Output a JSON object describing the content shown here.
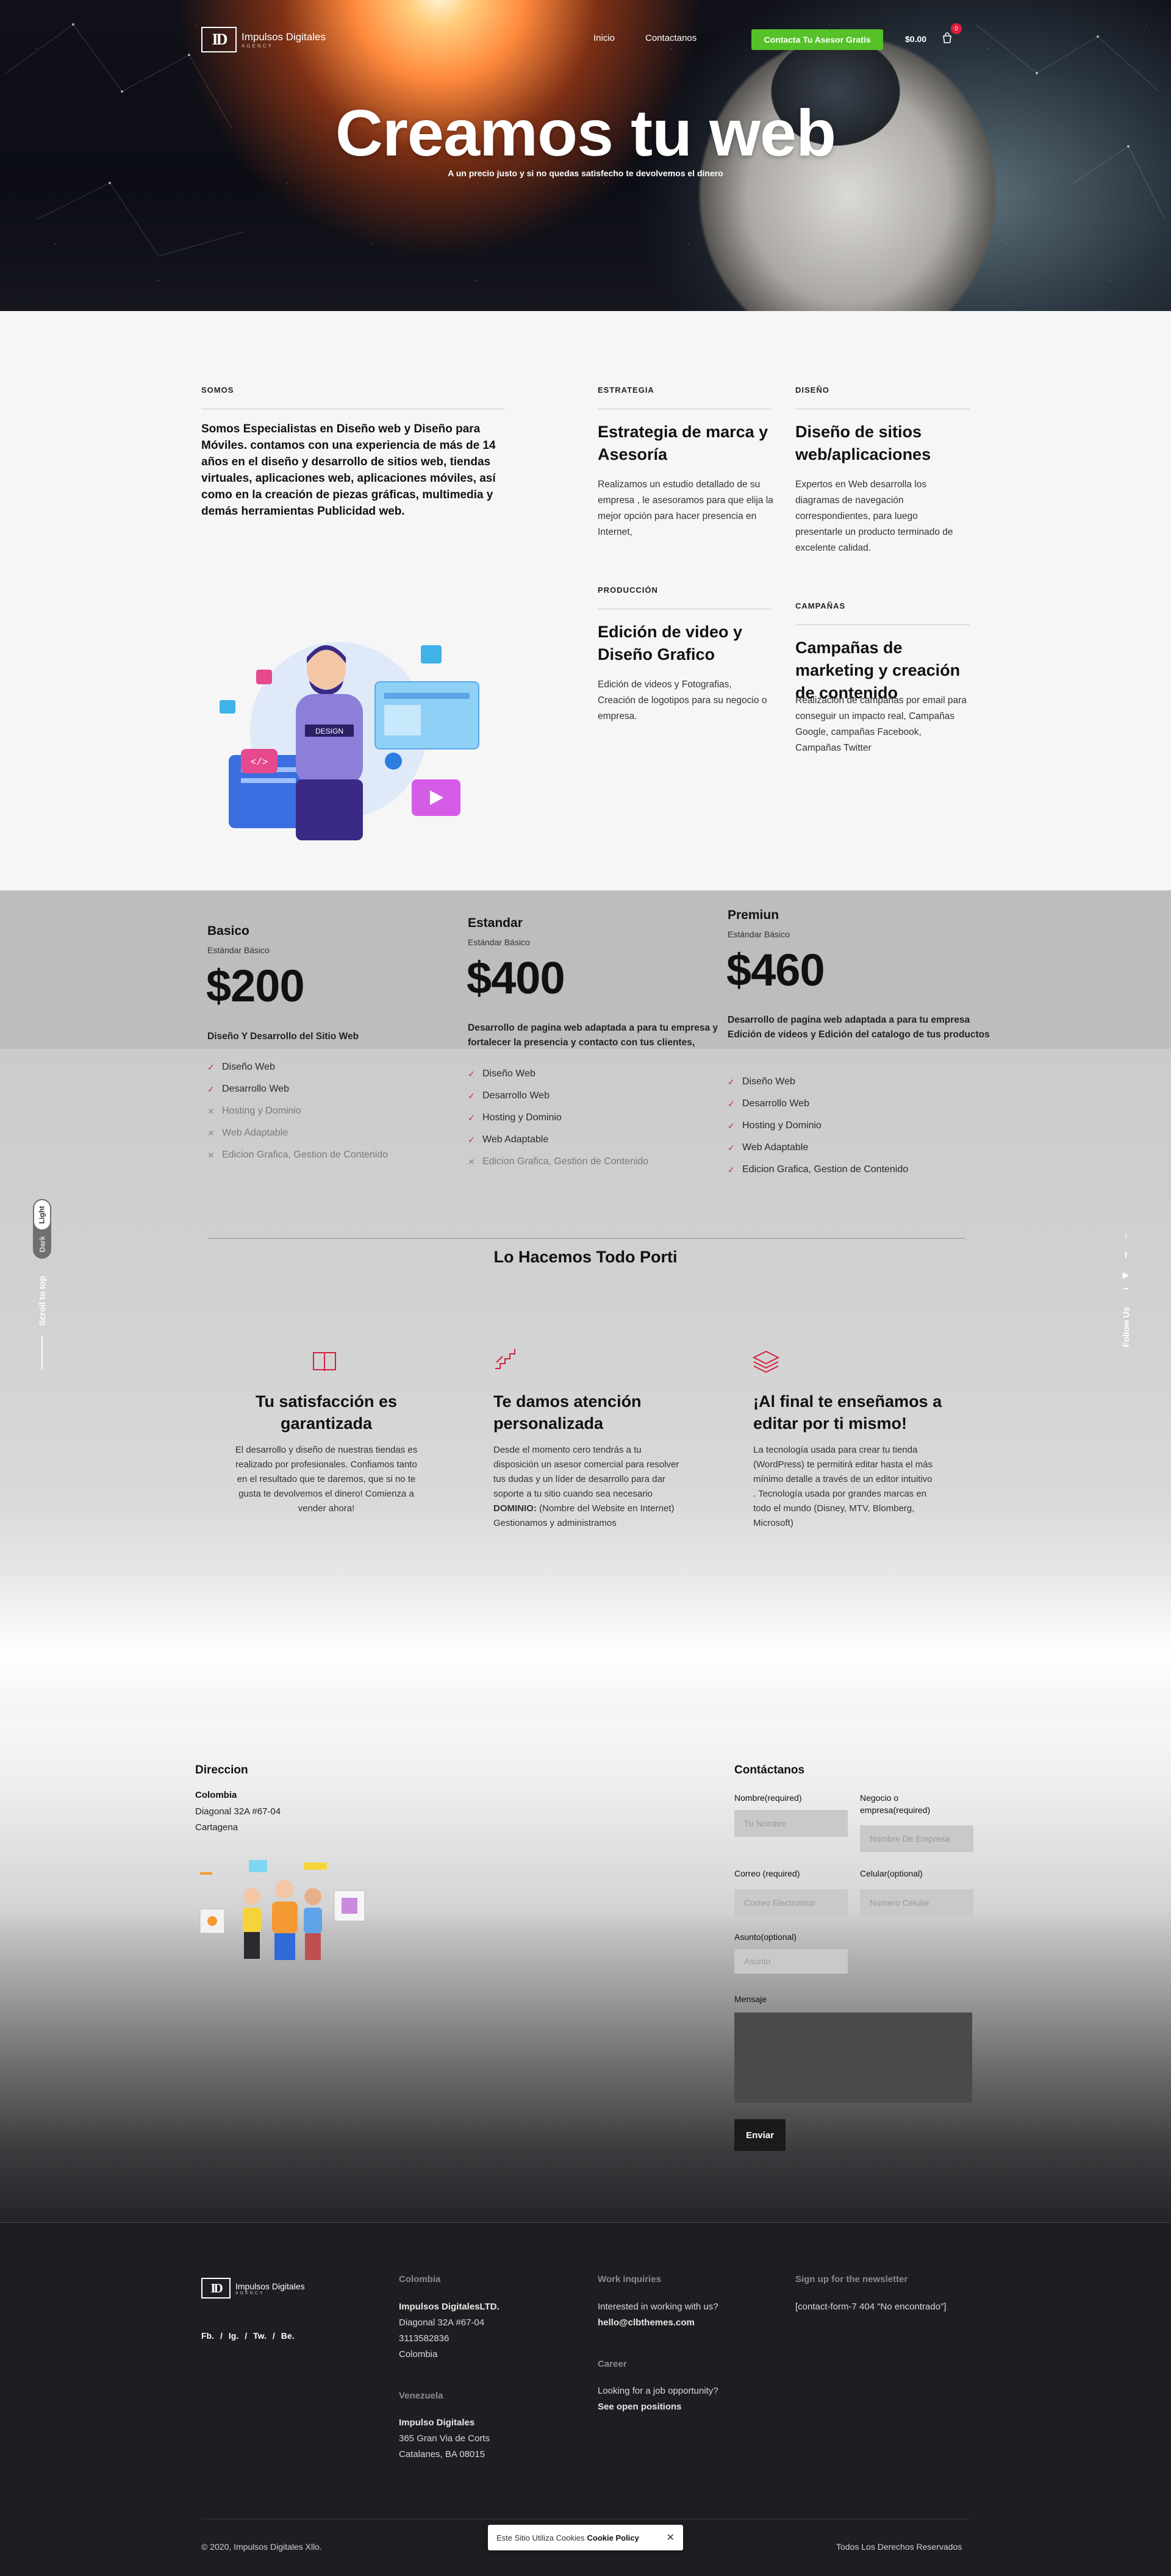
{
  "brand": {
    "mark": "ID",
    "name": "Impulsos Digitales",
    "tagline": "AGENCY"
  },
  "nav": {
    "items": [
      "Inicio",
      "Contactanos"
    ],
    "cta": "Contacta Tu Asesor Gratis",
    "cart_amount": "$0.00",
    "cart_count": "0"
  },
  "hero": {
    "title": "Creamos tu web",
    "subtitle": "A un precio justo y si no quedas satisfecho te devolvemos el dinero"
  },
  "services": {
    "intro_label": "SOMOS",
    "intro_text": "Somos Especialistas en Diseño web y Diseño para Móviles. contamos con una experiencia de más de 14 años en el diseño y desarrollo de sitios web, tiendas virtuales, aplicaciones web, aplicaciones móviles, así como en la creación de piezas gráficas, multimedia y demás herramientas Publicidad web.",
    "items": [
      {
        "label": "ESTRATEGIA",
        "title": "Estrategia de marca y Asesoría",
        "text": "Realizamos un estudio detallado de su empresa , le asesoramos para que elija la mejor opción para hacer presencia en Internet,"
      },
      {
        "label": "DISEÑO",
        "title": "Diseño de sitios web/aplicaciones",
        "text": "Expertos en Web desarrolla los diagramas de navegación correspondientes, para luego presentarle un producto terminado de excelente calidad."
      },
      {
        "label": "PRODUCCIÓN",
        "title": "Edición de video y Diseño Grafico",
        "text": "Edición de videos y Fotografias, Creación de logotipos para su negocio o empresa."
      },
      {
        "label": "CAMPAÑAS",
        "title": "Campañas de marketing y creación de contenido",
        "text": "Realización de campañas por email para conseguir un impacto real, Campañas Google, campañas Facebook, Campañas Twitter"
      }
    ]
  },
  "pricing": {
    "plans": [
      {
        "name": "Basico",
        "tag": "Estándar Básico",
        "price": "$200",
        "desc": "Diseño Y Desarrollo del Sitio Web",
        "features": [
          {
            "label": "Diseño Web",
            "included": true
          },
          {
            "label": "Desarrollo Web",
            "included": true
          },
          {
            "label": "Hosting y Dominio",
            "included": false
          },
          {
            "label": "Web Adaptable",
            "included": false
          },
          {
            "label": "Edicion Grafica, Gestion de Contenido",
            "included": false
          }
        ]
      },
      {
        "name": "Estandar",
        "tag": "Estándar Básico",
        "price": "$400",
        "desc": "Desarrollo de pagina web adaptada a para tu empresa y fortalecer la presencia y contacto con tus clientes,",
        "features": [
          {
            "label": "Diseño Web",
            "included": true
          },
          {
            "label": "Desarrollo Web",
            "included": true
          },
          {
            "label": "Hosting y Dominio",
            "included": true
          },
          {
            "label": "Web Adaptable",
            "included": true
          },
          {
            "label": "Edicion Grafica, Gestion de Contenido",
            "included": false
          }
        ]
      },
      {
        "name": "Premiun",
        "tag": "Estándar Básico",
        "price": "$460",
        "desc": "Desarrollo de pagina web adaptada a para tu empresa Edición de videos y Edición del catalogo de tus productos",
        "features": [
          {
            "label": "Diseño Web",
            "included": true
          },
          {
            "label": "Desarrollo Web",
            "included": true
          },
          {
            "label": "Hosting y Dominio",
            "included": true
          },
          {
            "label": "Web Adaptable",
            "included": true
          },
          {
            "label": "Edicion Grafica, Gestion de Contenido",
            "included": true
          }
        ]
      }
    ]
  },
  "todo": {
    "title": "Lo Hacemos Todo Porti",
    "features": [
      {
        "icon": "book-icon",
        "title": "Tu satisfacción es garantizada",
        "text": "El desarrollo y diseño de nuestras tiendas es realizado por profesionales. Confiamos tanto en el resultado que te daremos, que si no te gusta te devolvemos el dinero! Comienza a vender ahora!"
      },
      {
        "icon": "stairs-icon",
        "title": "Te damos atención personalizada",
        "text": "Desde el momento cero tendrás a tu disposición un asesor comercial para resolver tus dudas y un líder de desarrollo para dar soporte a tu sitio cuando sea necesario",
        "extra_bold": "DOMINIO:",
        "extra_text": " (Nombre del Website en Internet) Gestionamos y administramos"
      },
      {
        "icon": "layers-icon",
        "title": "¡Al final te enseñamos a editar por ti mismo!",
        "text": "La tecnología usada para crear tu tienda (WordPress) te permitirá editar hasta el más mínimo detalle a través de un editor intuitivo . Tecnología usada por grandes marcas en todo el mundo (Disney, MTV, Blomberg, Microsoft)"
      }
    ]
  },
  "side": {
    "light": "Light",
    "dark": "Dark",
    "scroll_top": "Scroll to top",
    "follow": "Follow Us"
  },
  "contact": {
    "address_title": "Direccion",
    "country": "Colombia",
    "address": "Diagonal 32A #67-04",
    "city": "Cartagena",
    "form_title": "Contáctanos",
    "fields": {
      "name_label": "Nombre(required)",
      "name_ph": "Tu Nombre",
      "company_label": "Negocio o empresa(required)",
      "company_ph": "Nombre De Empresa",
      "email_label": "Correo (required)",
      "email_ph": "Correo Electronico",
      "phone_label": "Celular(optional)",
      "phone_ph": "Numero Celular",
      "subject_label": "Asunto(optional)",
      "subject_ph": "Asunto",
      "message_label": "Mensaje"
    },
    "send": "Enviar"
  },
  "footer": {
    "social": [
      "Fb.",
      "/",
      "Ig.",
      "/",
      "Tw.",
      "/",
      "Be."
    ],
    "col1": {
      "head": "Colombia",
      "name": "Impulsos DigitalesLTD.",
      "lines": [
        "Diagonal 32A #67-04",
        "3113582836",
        "Colombia"
      ]
    },
    "col1b": {
      "head": "Venezuela",
      "name": "Impulso Digitales",
      "lines": [
        "365 Gran Via de Corts",
        "Catalanes, BA 08015"
      ]
    },
    "col2": {
      "head": "Work inquiries",
      "line": "Interested in working with us?",
      "email": "hello@clbthemes.com",
      "head2": "Career",
      "line2": "Looking for a job opportunity?",
      "link2": "See open positions"
    },
    "col3": {
      "head": "Sign up for the newsletter",
      "line": "[contact-form-7 404 \"No encontrado\"]"
    },
    "copyright": "© 2020, Impulsos Digitales Xllo.",
    "rights": "Todos Los Derechos Reservados",
    "cookie_text": "Este Sitio Utiliza Cookies",
    "cookie_link": "Cookie Policy",
    "cookie_close": "✕"
  }
}
